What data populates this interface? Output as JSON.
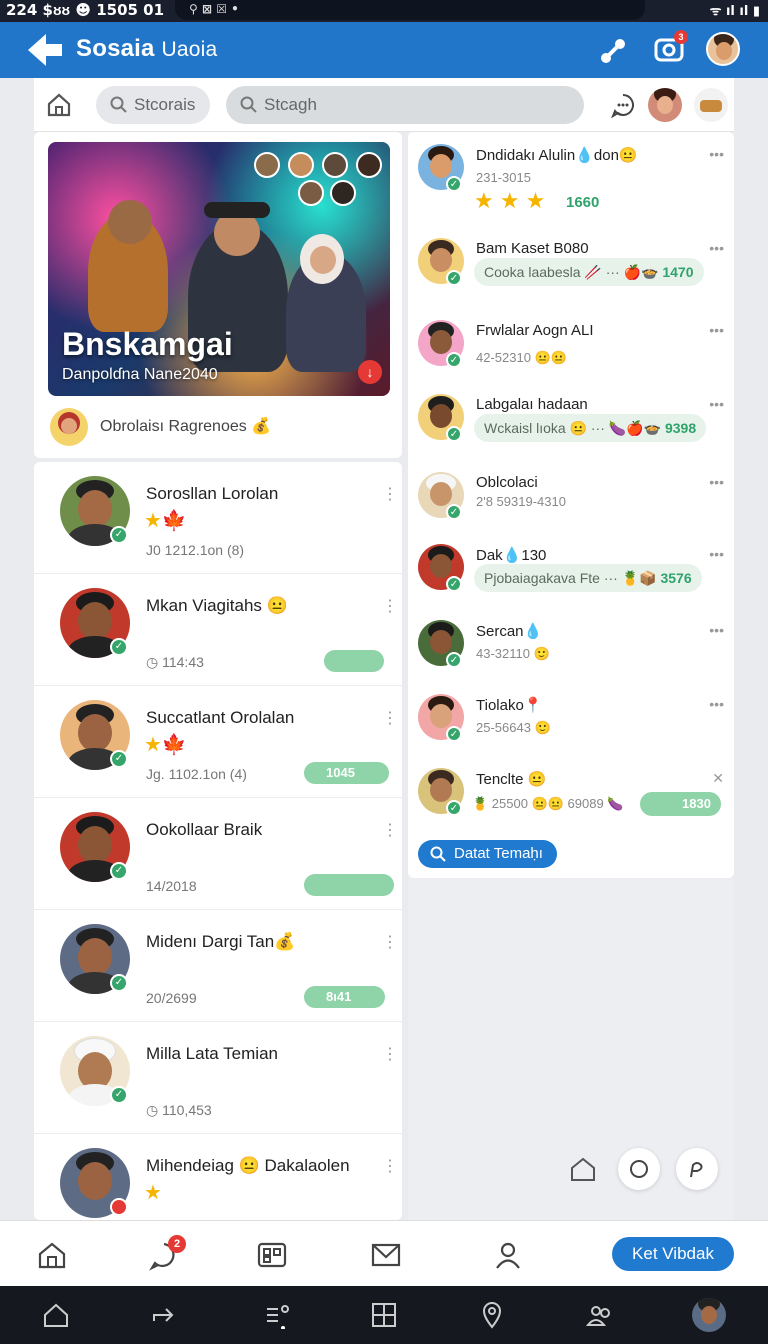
{
  "status": {
    "left": "224 $ᴕᴕ ☻ 1505 01",
    "pill": "⚲  ⊠  ☒ •",
    "right": "ᯤ ıl ıl ▮"
  },
  "appbar": {
    "title": "Sosaia",
    "subtitle": "Uaoia",
    "camera_badge": "3"
  },
  "search": {
    "chip1": "Stcorais",
    "chip2": "Stcagh"
  },
  "hero": {
    "title": "Bnskamgai",
    "subtitle": "Danpolɗna Nane2040",
    "footer": "Obrolaisı Ragrenoes 💰"
  },
  "left_list": [
    {
      "name": "Sorosllan Lorolan",
      "meta": "J0 1212.1on (8)",
      "stars": "★🍁",
      "pill": ""
    },
    {
      "name": "Mkan Viagitahs 😐",
      "meta": "◷ 114:43",
      "stars": "",
      "pill": ""
    },
    {
      "name": "Succatlant Orolalan",
      "meta": "Jg. 1102.1on (4)",
      "stars": "★🍁",
      "pill": "1045"
    },
    {
      "name": "Ookollaar Braik",
      "meta": "14/2018",
      "stars": "",
      "pill": ""
    },
    {
      "name": "Midenı Dargi Tan💰",
      "meta": "20/2699",
      "stars": "",
      "pill": "8ı41"
    },
    {
      "name": "Milla Lata  Temian",
      "meta": "◷ 110,453",
      "stars": "",
      "pill": ""
    },
    {
      "name": "Mihendeiag 😐 Dakalaolen",
      "meta": "",
      "stars": "★",
      "pill": ""
    }
  ],
  "right_list": [
    {
      "name": "Dndidakı Alulin💧don😐",
      "meta": "231-3015",
      "stars": "★ ★ ★",
      "num": "1660",
      "bubble": "",
      "bubble_num": ""
    },
    {
      "name": "Bam Kaset B080",
      "meta": "",
      "stars": "",
      "num": "",
      "bubble": "Cooka laabesla 🥢 ··· 🍎🍲",
      "bubble_num": "1470"
    },
    {
      "name": "Frwlalar Aogn ALI",
      "meta": "42-52310  😐😐",
      "stars": "",
      "num": "",
      "bubble": "",
      "bubble_num": ""
    },
    {
      "name": "Labgalaı hadaan",
      "meta": "",
      "stars": "",
      "num": "",
      "bubble": "Wckaisl lıoka 😐 ··· 🍆🍎🍲",
      "bubble_num": "9398"
    },
    {
      "name": "Oblcolaci",
      "meta": "2'8 59319-4310",
      "stars": "",
      "num": "",
      "bubble": "",
      "bubble_num": ""
    },
    {
      "name": "Dak💧130",
      "meta": "",
      "stars": "",
      "num": "",
      "bubble": "Pjobaiagakava Fte ··· 🍍📦",
      "bubble_num": "3576"
    },
    {
      "name": "Sercan💧",
      "meta": "43-32110  🙂",
      "stars": "",
      "num": "",
      "bubble": "",
      "bubble_num": ""
    },
    {
      "name": "Tiolako📍",
      "meta": "25-56643  🙂",
      "stars": "",
      "num": "",
      "bubble": "",
      "bubble_num": ""
    },
    {
      "name": "Tenclte 😐",
      "meta": "🍍 25500  😐😐 69089 🍆",
      "stars": "",
      "num": "",
      "bubble": "",
      "bubble_num": "1830"
    }
  ],
  "right_button": "Datat Temaḥı",
  "bottomnav": {
    "chat_badge": "2",
    "cta": "Ket Vibdak"
  },
  "colors": {
    "primary": "#2176c9",
    "accent_green": "#36a56b",
    "pill_green": "#8fd3a8",
    "star": "#f5b400"
  }
}
